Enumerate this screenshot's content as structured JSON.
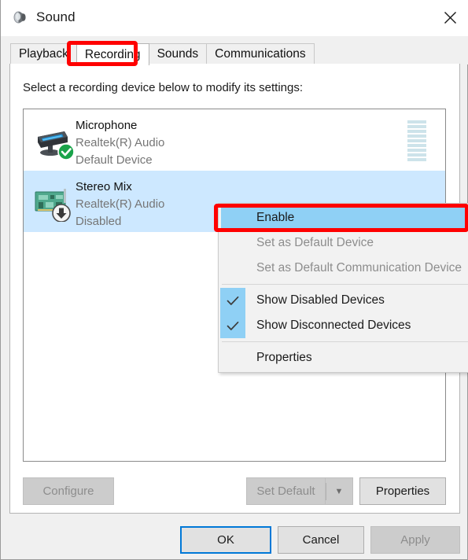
{
  "window": {
    "title": "Sound",
    "icon": "speaker-icon",
    "close_label": "✕"
  },
  "tabs": [
    {
      "label": "Playback",
      "active": false
    },
    {
      "label": "Recording",
      "active": true
    },
    {
      "label": "Sounds",
      "active": false
    },
    {
      "label": "Communications",
      "active": false
    }
  ],
  "panel": {
    "instruction": "Select a recording device below to modify its settings:"
  },
  "devices": [
    {
      "name": "Microphone",
      "driver": "Realtek(R) Audio",
      "status": "Default Device",
      "icon": "microphone-device-icon",
      "badge": "check-badge-icon",
      "selected": false,
      "meter_segments": 9,
      "meter_active": 0
    },
    {
      "name": "Stereo Mix",
      "driver": "Realtek(R) Audio",
      "status": "Disabled",
      "icon": "sound-card-device-icon",
      "badge": "down-arrow-badge-icon",
      "selected": true,
      "meter_segments": 0,
      "meter_active": 0
    }
  ],
  "context_menu": {
    "items": [
      {
        "label": "Enable",
        "state": "highlighted",
        "checked": false
      },
      {
        "label": "Set as Default Device",
        "state": "disabled",
        "checked": false
      },
      {
        "label": "Set as Default Communication Device",
        "state": "disabled",
        "checked": false
      },
      {
        "separator": true
      },
      {
        "label": "Show Disabled Devices",
        "state": "normal",
        "checked": true
      },
      {
        "label": "Show Disconnected Devices",
        "state": "normal",
        "checked": true
      },
      {
        "separator": true
      },
      {
        "label": "Properties",
        "state": "normal",
        "checked": false
      }
    ]
  },
  "buttons": {
    "configure": {
      "label": "Configure",
      "enabled": false
    },
    "set_default": {
      "label": "Set Default",
      "enabled": false
    },
    "set_default_arrow": {
      "label": "▼",
      "enabled": false
    },
    "properties": {
      "label": "Properties",
      "enabled": true
    },
    "ok": {
      "label": "OK",
      "enabled": true,
      "default": true
    },
    "cancel": {
      "label": "Cancel",
      "enabled": true
    },
    "apply": {
      "label": "Apply",
      "enabled": false
    }
  },
  "annotations": {
    "accent_color": "#ff0000",
    "highlighted_tab": "Recording",
    "highlighted_menu_item": "Enable"
  }
}
